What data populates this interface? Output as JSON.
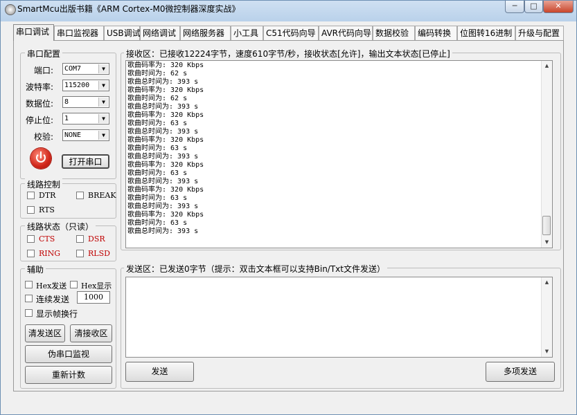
{
  "window": {
    "title": "SmartMcu出版书籍《ARM Cortex-M0微控制器深度实战》",
    "min_label": "─",
    "max_label": "□",
    "close_label": "✕"
  },
  "tabs": [
    "串口调试",
    "串口监视器",
    "USB调试",
    "网络调试",
    "网络服务器",
    "小工具",
    "C51代码向导",
    "AVR代码向导",
    "数据校验",
    "编码转换",
    "位图转16进制",
    "升级与配置"
  ],
  "serial_config": {
    "legend": "串口配置",
    "port_label": "端口:",
    "port_value": "COM7",
    "baud_label": "波特率:",
    "baud_value": "115200",
    "databits_label": "数据位:",
    "databits_value": "8",
    "stopbits_label": "停止位:",
    "stopbits_value": "1",
    "parity_label": "校验:",
    "parity_value": "NONE",
    "open_button": "打开串口"
  },
  "line_control": {
    "legend": "线路控制",
    "dtr": "DTR",
    "break": "BREAK",
    "rts": "RTS"
  },
  "line_status": {
    "legend": "线路状态（只读）",
    "cts": "CTS",
    "dsr": "DSR",
    "ring": "RING",
    "rlsd": "RLSD"
  },
  "aux": {
    "legend": "辅助",
    "hex_send": "Hex发送",
    "hex_display": "Hex显示",
    "continuous_send": "连续发送",
    "interval": "1000",
    "show_frame_newline": "显示帧换行",
    "clear_send": "清发送区",
    "clear_recv": "清接收区",
    "pseudo_monitor": "伪串口监视",
    "reset_count": "重新计数"
  },
  "receive": {
    "legend": "接收区：已接收12224字节，速度610字节/秒，接收状态[允许]，输出文本状态[已停止]",
    "lines": [
      "歌曲码率为: 320 Kbps",
      "歌曲时间为: 62 s",
      "歌曲总时间为: 393 s",
      "歌曲码率为: 320 Kbps",
      "歌曲时间为: 62 s",
      "歌曲总时间为: 393 s",
      "歌曲码率为: 320 Kbps",
      "歌曲时间为: 63 s",
      "歌曲总时间为: 393 s",
      "歌曲码率为: 320 Kbps",
      "歌曲时间为: 63 s",
      "歌曲总时间为: 393 s",
      "歌曲码率为: 320 Kbps",
      "歌曲时间为: 63 s",
      "歌曲总时间为: 393 s",
      "歌曲码率为: 320 Kbps",
      "歌曲时间为: 63 s",
      "歌曲总时间为: 393 s",
      "歌曲码率为: 320 Kbps",
      "歌曲时间为: 63 s",
      "歌曲总时间为: 393 s"
    ]
  },
  "send": {
    "legend": "发送区：已发送0字节（提示：双击文本框可以支持Bin/Txt文件发送）",
    "send_button": "发送",
    "multi_send_button": "多项发送"
  }
}
